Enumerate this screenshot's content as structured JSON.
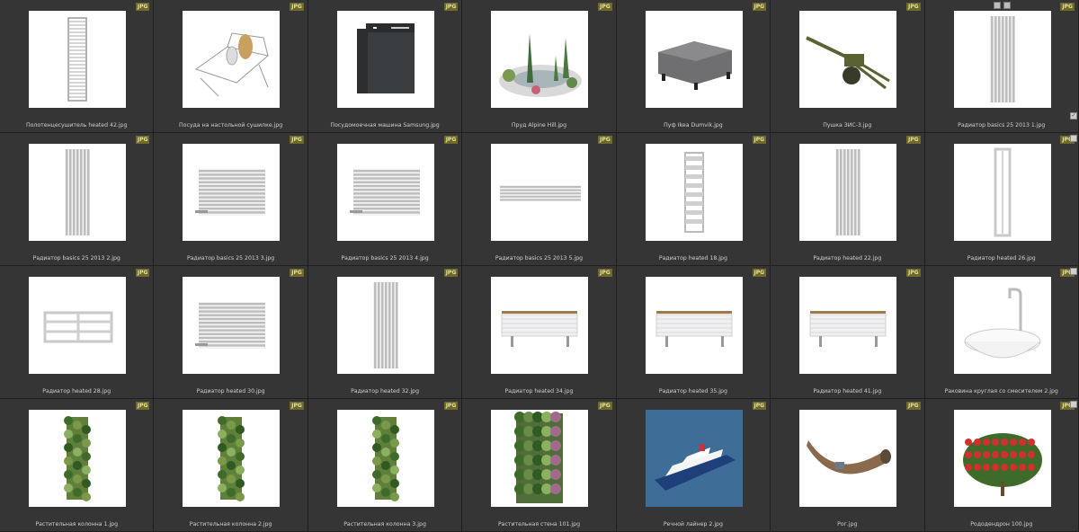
{
  "badge_label": "JPG",
  "accent_badge_color": "#6d6a2a",
  "items": [
    {
      "label": "Полотенцесушитель heated 42.jpg",
      "icon": "towel-rail-icon"
    },
    {
      "label": "Посуда на настольной сушилке.jpg",
      "icon": "dish-rack-icon"
    },
    {
      "label": "Посудомоечная машина Samsung.jpg",
      "icon": "dishwasher-icon"
    },
    {
      "label": "Пруд Alpine Hill.jpg",
      "icon": "pond-icon"
    },
    {
      "label": "Пуф Ikea Dumvik.jpg",
      "icon": "pouf-icon"
    },
    {
      "label": "Пушка ЗИС-3.jpg",
      "icon": "cannon-icon"
    },
    {
      "label": "Радиатор basics 25 2013 1.jpg",
      "icon": "radiator-vertical-icon"
    },
    {
      "label": "Радиатор basics 25 2013 2.jpg",
      "icon": "radiator-vertical-icon"
    },
    {
      "label": "Радиатор basics 25 2013 3.jpg",
      "icon": "radiator-horizontal-icon"
    },
    {
      "label": "Радиатор basics 25 2013 4.jpg",
      "icon": "radiator-horizontal-icon"
    },
    {
      "label": "Радиатор basics 25 2013 5.jpg",
      "icon": "radiator-low-icon"
    },
    {
      "label": "Радиатор heated 18.jpg",
      "icon": "ladder-radiator-icon"
    },
    {
      "label": "Радиатор heated 22.jpg",
      "icon": "radiator-vertical-icon"
    },
    {
      "label": "Радиатор heated 26.jpg",
      "icon": "radiator-frame-icon"
    },
    {
      "label": "Радиатор heated 28.jpg",
      "icon": "radiator-panel-icon"
    },
    {
      "label": "Радиатор heated 30.jpg",
      "icon": "radiator-horizontal-icon"
    },
    {
      "label": "Радиатор heated 32.jpg",
      "icon": "radiator-vertical-icon"
    },
    {
      "label": "Радиатор heated 34.jpg",
      "icon": "radiator-bench-icon"
    },
    {
      "label": "Радиатор heated 35.jpg",
      "icon": "radiator-bench-icon"
    },
    {
      "label": "Радиатор heated 41.jpg",
      "icon": "radiator-bench-icon"
    },
    {
      "label": "Раковина круглая со смесителем 2.jpg",
      "icon": "sink-icon"
    },
    {
      "label": "Растительная колонна 1.jpg",
      "icon": "plant-column-icon"
    },
    {
      "label": "Растительная колонна 2.jpg",
      "icon": "plant-column-icon"
    },
    {
      "label": "Растительная колонна 3.jpg",
      "icon": "plant-column-icon"
    },
    {
      "label": "Растительная стена 101.jpg",
      "icon": "plant-wall-icon"
    },
    {
      "label": "Речной лайнер 2.jpg",
      "icon": "ship-icon"
    },
    {
      "label": "Рог.jpg",
      "icon": "horn-icon"
    },
    {
      "label": "Рододендрон 100.jpg",
      "icon": "rhododendron-icon"
    }
  ]
}
